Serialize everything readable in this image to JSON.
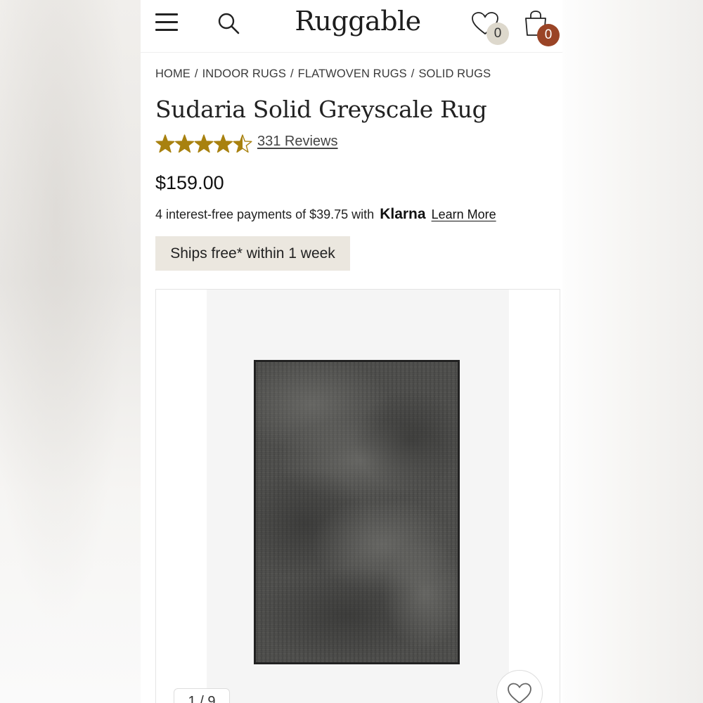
{
  "header": {
    "logo": "Ruggable",
    "wishlist_count": "0",
    "cart_count": "0",
    "icons": [
      "menu-icon",
      "search-icon",
      "heart-icon",
      "shopping-bag-icon"
    ]
  },
  "breadcrumb": [
    "HOME",
    "INDOOR RUGS",
    "FLATWOVEN RUGS",
    "SOLID RUGS"
  ],
  "product": {
    "title": "Sudaria Solid Greyscale Rug",
    "rating": 4.5,
    "rating_max": 5,
    "reviews": "331 Reviews",
    "price": "$159.00",
    "installments_text": "4 interest-free payments of $39.75 with",
    "klarna": "Klarna",
    "learn_more": "Learn More",
    "shipping": "Ships free* within 1 week"
  },
  "gallery": {
    "counter": "1 / 9"
  },
  "colors": {
    "star": "#a8810f",
    "cart_badge": "#9a4426",
    "wish_badge": "#ddd8cc",
    "shipping_bg": "#ebe7df"
  }
}
